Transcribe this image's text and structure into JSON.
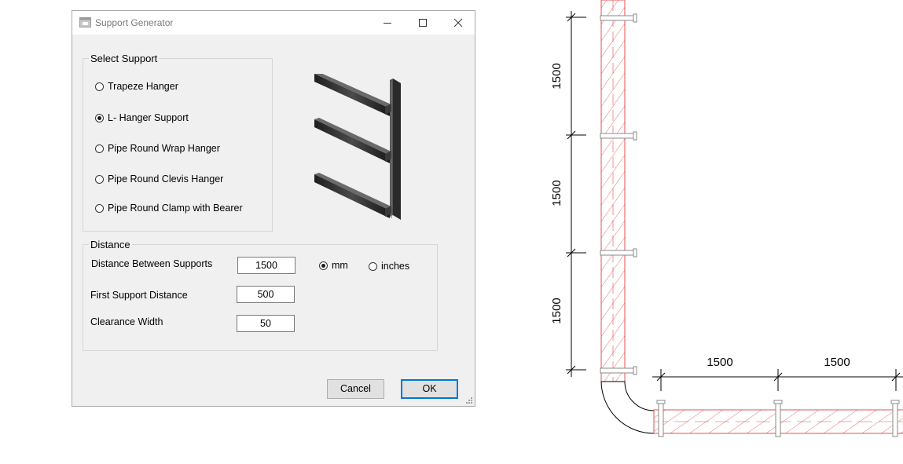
{
  "window": {
    "title": "Support Generator",
    "icon": "app-window-icon",
    "controls": [
      "minimize-icon",
      "maximize-icon",
      "close-icon"
    ]
  },
  "select_support": {
    "title": "Select Support",
    "options": [
      {
        "label": "Trapeze Hanger",
        "checked": false
      },
      {
        "label": "L- Hanger Support",
        "checked": true
      },
      {
        "label": "Pipe Round Wrap Hanger",
        "checked": false
      },
      {
        "label": "Pipe Round Clevis Hanger",
        "checked": false
      },
      {
        "label": "Pipe Round Clamp with Bearer",
        "checked": false
      }
    ],
    "preview": "l-hanger-support-preview"
  },
  "distance": {
    "title": "Distance",
    "between_label": "Distance Between Supports",
    "between_value": "1500",
    "first_label": "First Support Distance",
    "first_value": "500",
    "clearance_label": "Clearance Width",
    "clearance_value": "50",
    "units": [
      {
        "label": "mm",
        "checked": true
      },
      {
        "label": "inches",
        "checked": false
      }
    ]
  },
  "buttons": {
    "cancel": "Cancel",
    "ok": "OK"
  },
  "drawing": {
    "vertical_dims": [
      "1500",
      "1500",
      "1500"
    ],
    "horizontal_dims": [
      "1500",
      "1500"
    ],
    "hatch_color": "#e05050",
    "pipe_color": "#888888"
  },
  "colors": {
    "accent": "#0078d7",
    "window_bg": "#f0f0f0"
  }
}
